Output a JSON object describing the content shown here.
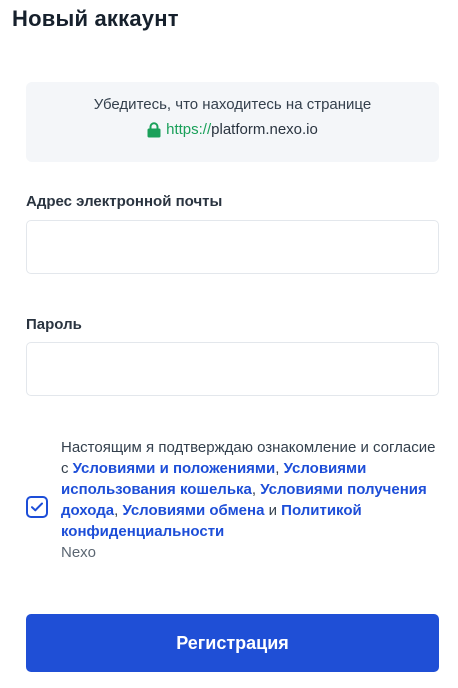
{
  "header": {
    "title": "Новый аккаунт"
  },
  "notice": {
    "line1": "Убедитесь, что находитесь на странице",
    "url_protocol": "https://",
    "url_host": "platform.nexo.io",
    "lock_icon": "lock-icon"
  },
  "form": {
    "email_label": "Адрес электронной почты",
    "email_value": "",
    "password_label": "Пароль",
    "password_value": ""
  },
  "consent": {
    "checked": true,
    "intro": "Настоящим я подтверждаю ознакомление и согласие с ",
    "link_terms": "Условиями и положениями",
    "sep1": ", ",
    "link_wallet": "Условиями использования кошелька",
    "sep2": ", ",
    "link_earn": "Условиями получения дохода",
    "sep3": ", ",
    "link_exchange": "Условиями обмена",
    "sep4": " и ",
    "link_privacy": "Политикой конфиденциальности",
    "brand": "Nexo"
  },
  "submit": {
    "label": "Регистрация"
  },
  "colors": {
    "accent": "#1f4fd6",
    "link": "#1d4ed8",
    "secure": "#1aa05a",
    "notice_bg": "#f4f6f9"
  }
}
